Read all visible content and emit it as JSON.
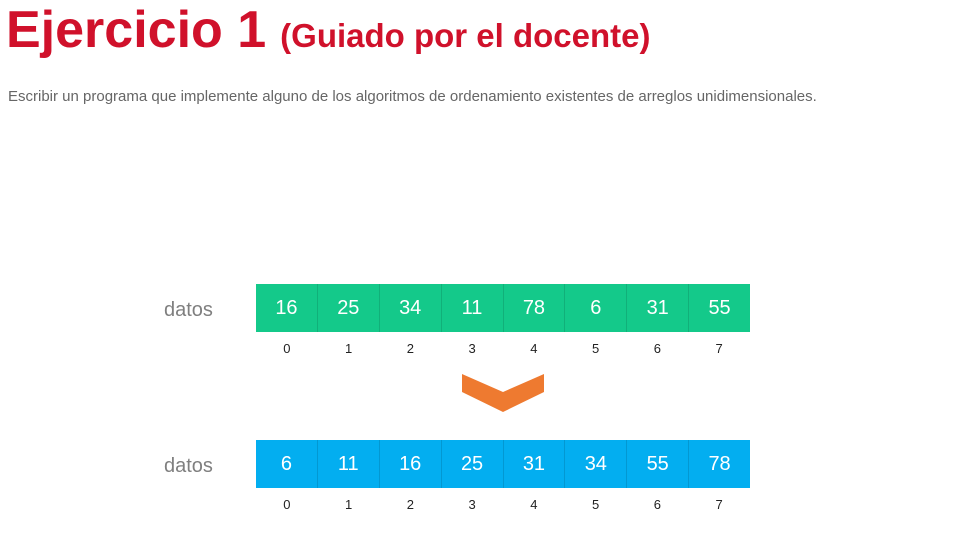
{
  "title": {
    "main": "Ejercicio 1",
    "sub": "(Guiado por el docente)"
  },
  "description": "Escribir un programa que implemente alguno de los algoritmos de ordenamiento existentes de arreglos unidimensionales.",
  "colors": {
    "title": "#d0112b",
    "unsorted": "#14c98a",
    "sorted": "#03aef0",
    "arrow": "#ee7a30"
  },
  "arrays": [
    {
      "label": "datos",
      "values": [
        "16",
        "25",
        "34",
        "11",
        "78",
        "6",
        "31",
        "55"
      ],
      "indices": [
        "0",
        "1",
        "2",
        "3",
        "4",
        "5",
        "6",
        "7"
      ]
    },
    {
      "label": "datos",
      "values": [
        "6",
        "11",
        "16",
        "25",
        "31",
        "34",
        "55",
        "78"
      ],
      "indices": [
        "0",
        "1",
        "2",
        "3",
        "4",
        "5",
        "6",
        "7"
      ]
    }
  ],
  "arrow_icon": "chevron-down-icon"
}
